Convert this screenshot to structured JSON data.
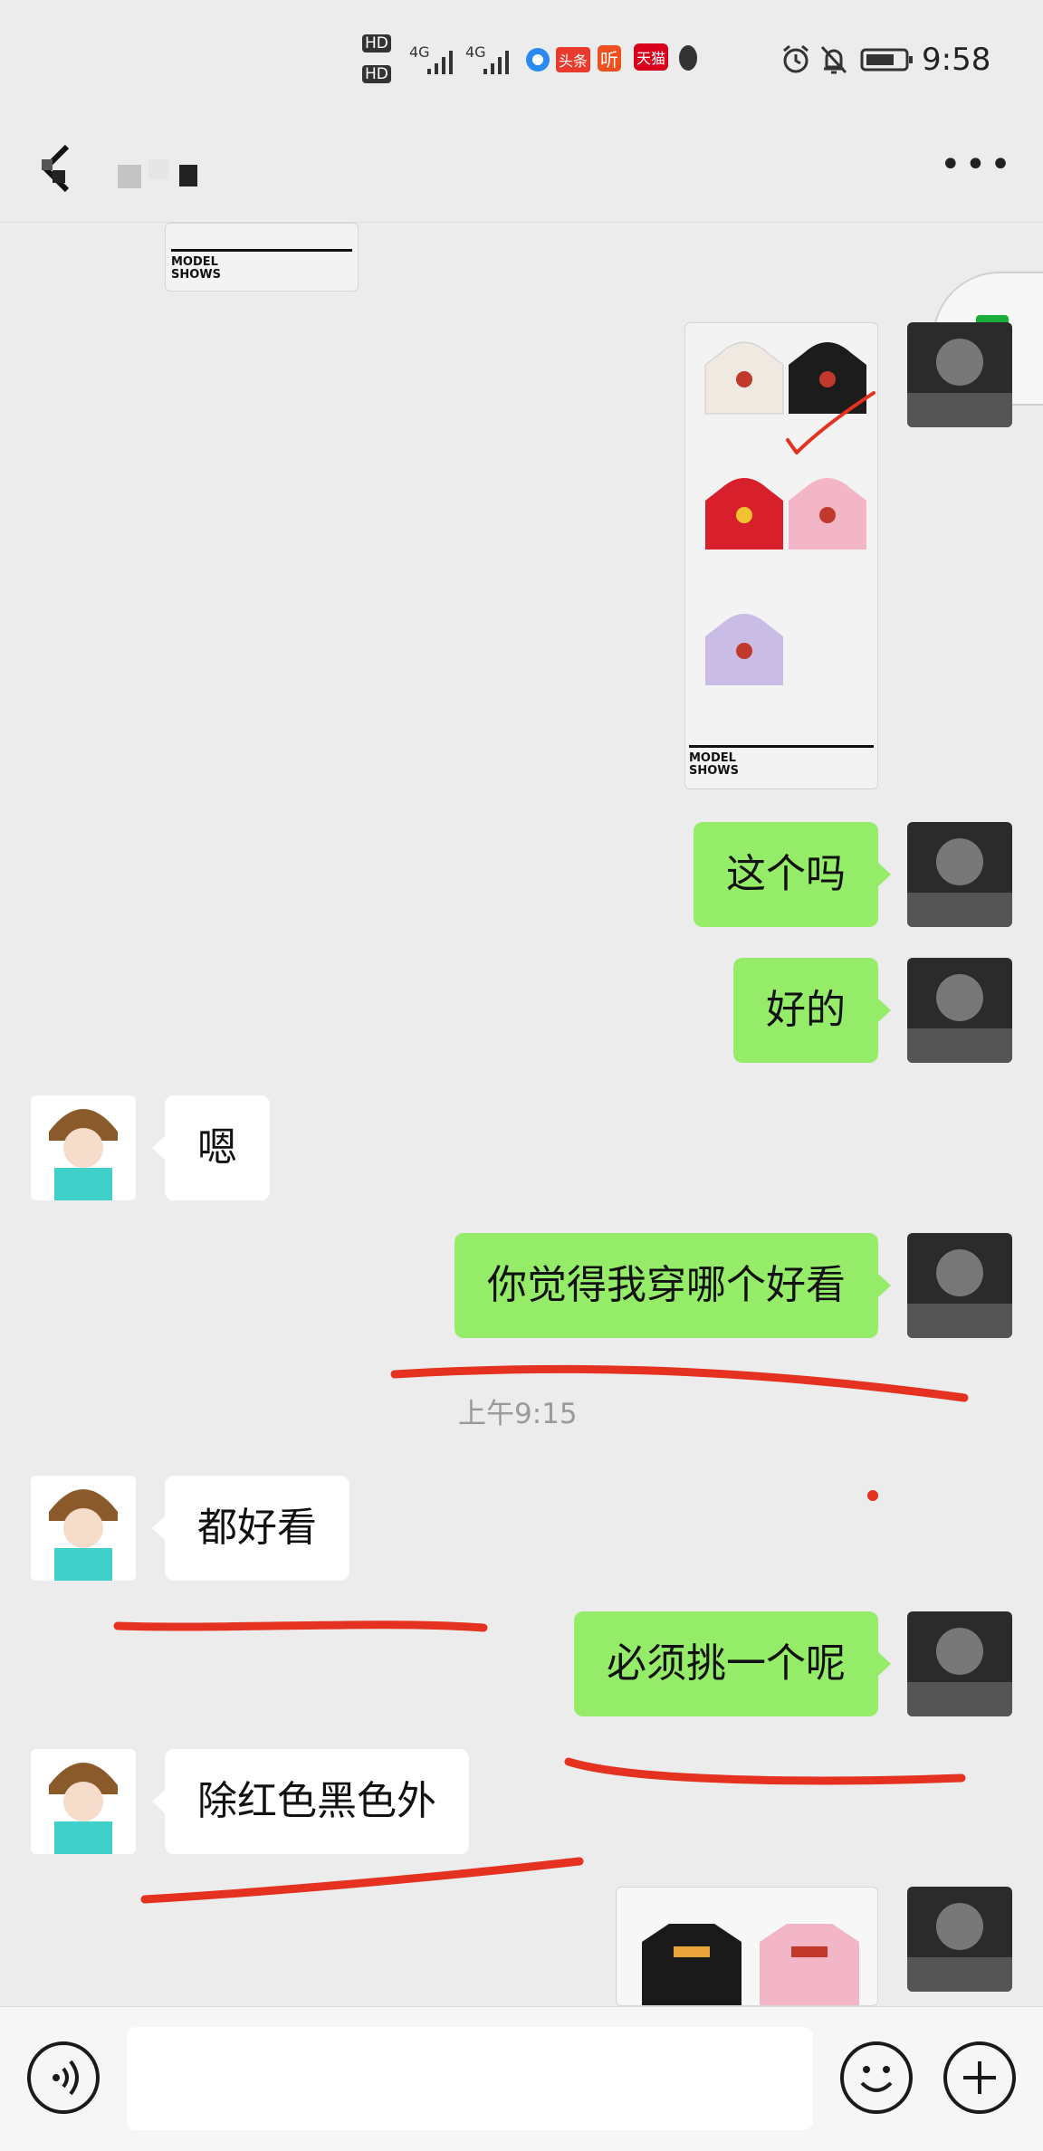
{
  "status_bar": {
    "time": "9:58",
    "network_labels": [
      "HD",
      "HD",
      "4G",
      "4G"
    ],
    "app_badges": [
      "头条",
      "听",
      "天猫"
    ]
  },
  "header": {
    "back_icon": "back-arrow-icon",
    "more_icon": "more-dots-icon"
  },
  "product_images": [
    {
      "caption": "MODEL SHOWS",
      "colors": [
        "#efe9e2",
        "#1c1c1c",
        "#d7202b",
        "#f2b6c6",
        "#c9bde6"
      ]
    },
    {
      "caption": "MODEL SHOWS"
    }
  ],
  "messages": [
    {
      "from": "me",
      "text": "这个吗"
    },
    {
      "from": "me",
      "text": "好的"
    },
    {
      "from": "them",
      "text": "嗯"
    },
    {
      "from": "me",
      "text": "你觉得我穿哪个好看"
    },
    {
      "from": "them",
      "text": "都好看"
    },
    {
      "from": "me",
      "text": "必须挑一个呢"
    },
    {
      "from": "them",
      "text": "除红色黑色外"
    }
  ],
  "timestamp": "上午9:15",
  "input_bar": {
    "voice_icon": "voice-icon",
    "emoji_icon": "emoji-icon",
    "plus_icon": "plus-icon",
    "placeholder": ""
  },
  "colors": {
    "my_bubble": "#95ec69",
    "their_bubble": "#ffffff",
    "background": "#ececec",
    "annotation": "#e5311f"
  }
}
